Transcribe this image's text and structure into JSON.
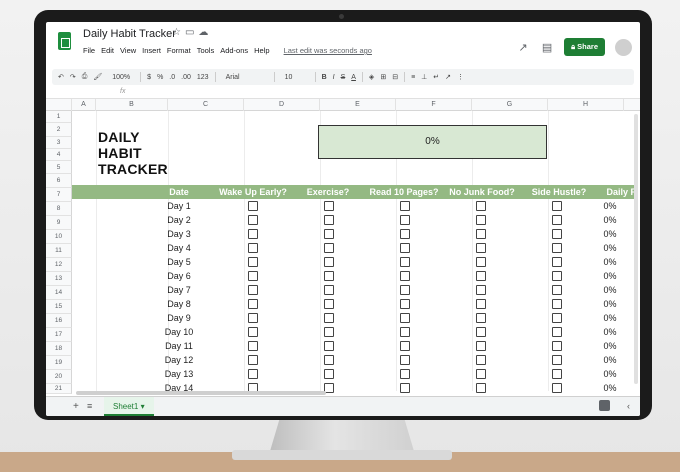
{
  "app": {
    "doc_title": "Daily Habit Tracker",
    "menu": [
      "File",
      "Edit",
      "View",
      "Insert",
      "Format",
      "Tools",
      "Add-ons",
      "Help"
    ],
    "last_edit": "Last edit was seconds ago",
    "share_label": "Share",
    "icons": {
      "star": "star-icon",
      "move": "folder-icon",
      "cloud": "cloud-icon",
      "trend": "trend-icon",
      "comment": "comment-icon",
      "lock": "lock-icon"
    }
  },
  "toolbar": {
    "zoom": "100%",
    "currency": "$",
    "percent": "%",
    "decimal_dec": ".0",
    "decimal_inc": ".00",
    "more_formats": "123",
    "font": "Arial",
    "font_size": "10",
    "bold": "B",
    "italic": "I",
    "strike": "S",
    "text_color": "A"
  },
  "formula_bar": {
    "fx": "fx"
  },
  "columns": [
    "A",
    "B",
    "C",
    "D",
    "E",
    "F",
    "G",
    "H"
  ],
  "rows": [
    "1",
    "2",
    "3",
    "4",
    "5",
    "6",
    "7",
    "8",
    "9",
    "10",
    "11",
    "12",
    "13",
    "14",
    "15",
    "16",
    "17",
    "18",
    "19",
    "20",
    "21"
  ],
  "sheet": {
    "title": "DAILY HABIT TRACKER",
    "overall_progress": "0%",
    "headers": [
      "Date",
      "Wake Up Early?",
      "Exercise?",
      "Read 10 Pages?",
      "No Junk Food?",
      "Side Hustle?",
      "Daily Progress"
    ],
    "days": [
      {
        "label": "Day 1",
        "progress": "0%"
      },
      {
        "label": "Day 2",
        "progress": "0%"
      },
      {
        "label": "Day 3",
        "progress": "0%"
      },
      {
        "label": "Day 4",
        "progress": "0%"
      },
      {
        "label": "Day 5",
        "progress": "0%"
      },
      {
        "label": "Day 6",
        "progress": "0%"
      },
      {
        "label": "Day 7",
        "progress": "0%"
      },
      {
        "label": "Day 8",
        "progress": "0%"
      },
      {
        "label": "Day 9",
        "progress": "0%"
      },
      {
        "label": "Day 10",
        "progress": "0%"
      },
      {
        "label": "Day 11",
        "progress": "0%"
      },
      {
        "label": "Day 12",
        "progress": "0%"
      },
      {
        "label": "Day 13",
        "progress": "0%"
      },
      {
        "label": "Day 14",
        "progress": "0%"
      }
    ],
    "colors": {
      "header_green": "#94b983",
      "progress_fill": "#d8e8d3",
      "share_green": "#1e7e34"
    }
  },
  "sheet_tabs": {
    "active": "Sheet1",
    "add": "+",
    "list": "≡"
  }
}
